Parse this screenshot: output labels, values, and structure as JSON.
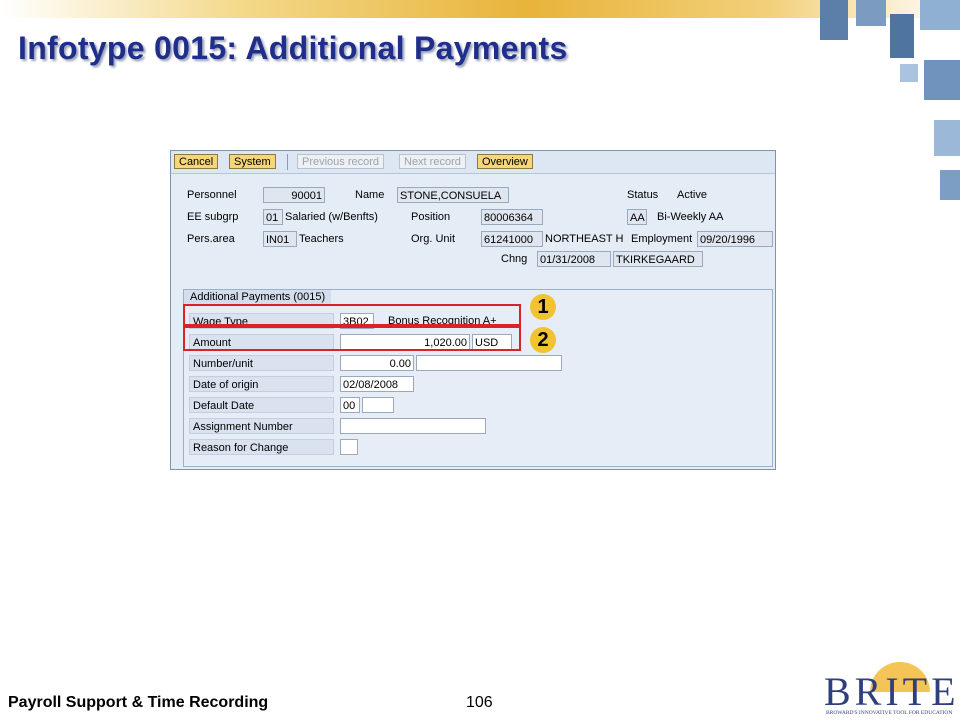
{
  "slide": {
    "title": "Infotype 0015: Additional Payments",
    "footer_left": "Payroll Support & Time Recording",
    "page_number": "106",
    "logo_text": "BRITE",
    "logo_subtitle": "BROWARD'S INNOVATIVE TOOL FOR EDUCATION"
  },
  "toolbar": {
    "cancel": "Cancel",
    "system": "System",
    "previous": "Previous record",
    "next": "Next record",
    "overview": "Overview"
  },
  "header": {
    "personnel_label": "Personnel",
    "personnel_value": "90001",
    "name_label": "Name",
    "name_value": "STONE,CONSUELA",
    "status_label": "Status",
    "status_value": "Active",
    "ee_subgrp_label": "EE subgrp",
    "ee_subgrp_code": "01",
    "ee_subgrp_text": "Salaried (w/Benfts)",
    "position_label": "Position",
    "position_value": "80006364",
    "payroll_area_code": "AA",
    "payroll_area_text": "Bi-Weekly AA",
    "pers_area_label": "Pers.area",
    "pers_area_code": "IN01",
    "pers_area_text": "Teachers",
    "org_unit_label": "Org. Unit",
    "org_unit_value": "61241000",
    "org_unit_text": "NORTHEAST H",
    "employment_label": "Employment",
    "employment_date": "09/20/1996",
    "chng_label": "Chng",
    "chng_date": "01/31/2008",
    "chng_user": "TKIRKEGAARD"
  },
  "section": {
    "title": "Additional Payments (0015)",
    "wage_type_label": "Wage Type",
    "wage_type_code": "3B02",
    "wage_type_text": "Bonus Recognition A+",
    "amount_label": "Amount",
    "amount_value": "1,020.00",
    "currency": "USD",
    "number_unit_label": "Number/unit",
    "number_unit_value": "0.00",
    "date_of_origin_label": "Date of origin",
    "date_of_origin_value": "02/08/2008",
    "default_date_label": "Default Date",
    "default_date_value": "00",
    "assignment_number_label": "Assignment Number",
    "reason_for_change_label": "Reason for Change"
  },
  "markers": [
    "1",
    "2"
  ],
  "colors": {
    "title": "#1f2e8a",
    "highlight": "#d8232a",
    "marker": "#f1c232",
    "button": "#f5d67a"
  }
}
